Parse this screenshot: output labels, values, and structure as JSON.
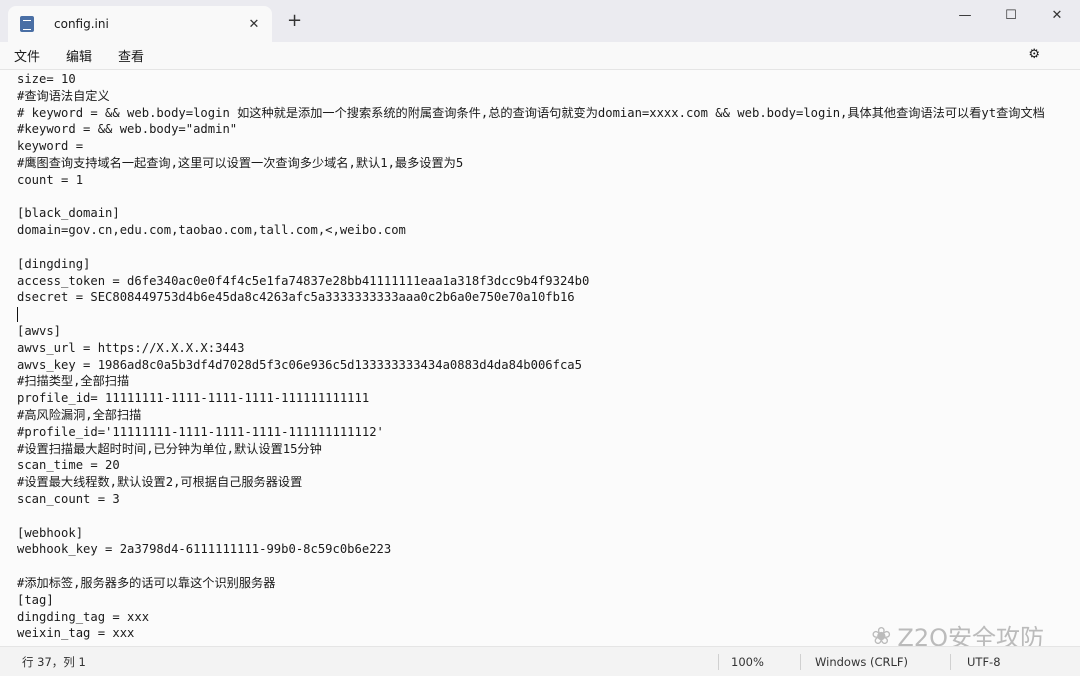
{
  "tab": {
    "title": "config.ini",
    "close": "✕",
    "new": "+"
  },
  "window": {
    "minimize": "—",
    "maximize": "☐",
    "close": "✕"
  },
  "menu": {
    "file": "文件",
    "edit": "编辑",
    "view": "查看",
    "settings_icon": "gear-icon"
  },
  "lines": [
    "size= 10",
    "#查询语法自定义",
    "# keyword = && web.body=login 如这种就是添加一个搜索系统的附属查询条件,总的查询语句就变为domian=xxxx.com && web.body=login,具体其他查询语法可以看yt查询文档",
    "#keyword = && web.body=\"admin\"",
    "keyword =",
    "#鹰图查询支持域名一起查询,这里可以设置一次查询多少域名,默认1,最多设置为5",
    "count = 1",
    "",
    "[black_domain]",
    "domain=gov.cn,edu.com,taobao.com,tall.com,<,weibo.com",
    "",
    "[dingding]",
    "access_token = d6fe340ac0e0f4f4c5e1fa74837e28bb41111111eaa1a318f3dcc9b4f9324b0",
    "dsecret = SEC808449753d4b6e45da8c4263afc5a3333333333aaa0c2b6a0e750e70a10fb16",
    "",
    "[awvs]",
    "awvs_url = https://X.X.X.X:3443",
    "awvs_key = 1986ad8c0a5b3df4d7028d5f3c06e936c5d133333333434a0883d4da84b006fca5",
    "#扫描类型,全部扫描",
    "profile_id= 11111111-1111-1111-1111-111111111111",
    "#高风险漏洞,全部扫描",
    "#profile_id='11111111-1111-1111-1111-111111111112'",
    "#设置扫描最大超时时间,已分钟为单位,默认设置15分钟",
    "scan_time = 20",
    "#设置最大线程数,默认设置2,可根据自己服务器设置",
    "scan_count = 3",
    "",
    "[webhook]",
    "webhook_key = 2a3798d4-6111111111-99b0-8c59c0b6e223",
    "",
    "#添加标签,服务器多的话可以靠这个识别服务器",
    "[tag]",
    "dingding_tag = xxx",
    "weixin_tag = xxx"
  ],
  "watermark": "Z2O安全攻防",
  "status": {
    "position": "行 37，列 1",
    "zoom": "100%",
    "line_ending": "Windows (CRLF)",
    "encoding": "UTF-8"
  }
}
